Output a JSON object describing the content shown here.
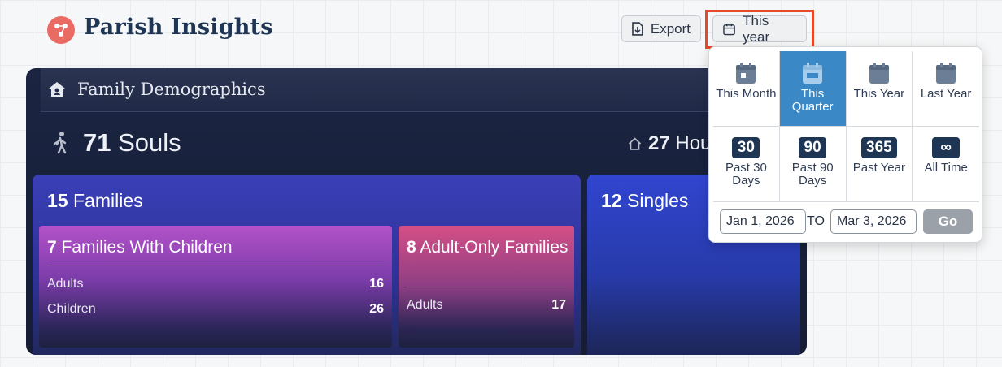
{
  "header": {
    "title": "Parish Insights",
    "export_label": "Export",
    "range_label": "This year"
  },
  "card": {
    "title": "Family Demographics",
    "souls_count": "71",
    "souls_label": "Souls",
    "households_count": "27",
    "households_label": "Hou",
    "families": {
      "count": "15",
      "label": "Families",
      "with_children": {
        "count": "7",
        "label": "Families With Children",
        "rows": [
          {
            "label": "Adults",
            "value": "16"
          },
          {
            "label": "Children",
            "value": "26"
          }
        ]
      },
      "adult_only": {
        "count": "8",
        "label": "Adult-Only Families",
        "rows": [
          {
            "label": "Adults",
            "value": "17"
          }
        ]
      }
    },
    "singles": {
      "count": "12",
      "label": "Singles"
    }
  },
  "dropdown": {
    "options": [
      {
        "label": "This Month",
        "icon": "calendar-icon",
        "selected": false
      },
      {
        "label": "This Quarter",
        "icon": "calendar-icon",
        "selected": true
      },
      {
        "label": "This Year",
        "icon": "calendar-icon",
        "selected": false
      },
      {
        "label": "Last Year",
        "icon": "calendar-icon",
        "selected": false
      },
      {
        "badge": "30",
        "label": "Past 30 Days",
        "selected": false
      },
      {
        "badge": "90",
        "label": "Past 90 Days",
        "selected": false
      },
      {
        "badge": "365",
        "label": "Past Year",
        "selected": false
      },
      {
        "badge": "∞",
        "label": "All Time",
        "selected": false
      }
    ],
    "from_date": "Jan 1, 2026",
    "to_label": "TO",
    "to_date": "Mar 3, 2026",
    "go_label": "Go"
  },
  "colors": {
    "highlight": "#e64a2a",
    "selected_option": "#3b88c6",
    "badge": "#1f3554",
    "logo": "#e96b64"
  }
}
